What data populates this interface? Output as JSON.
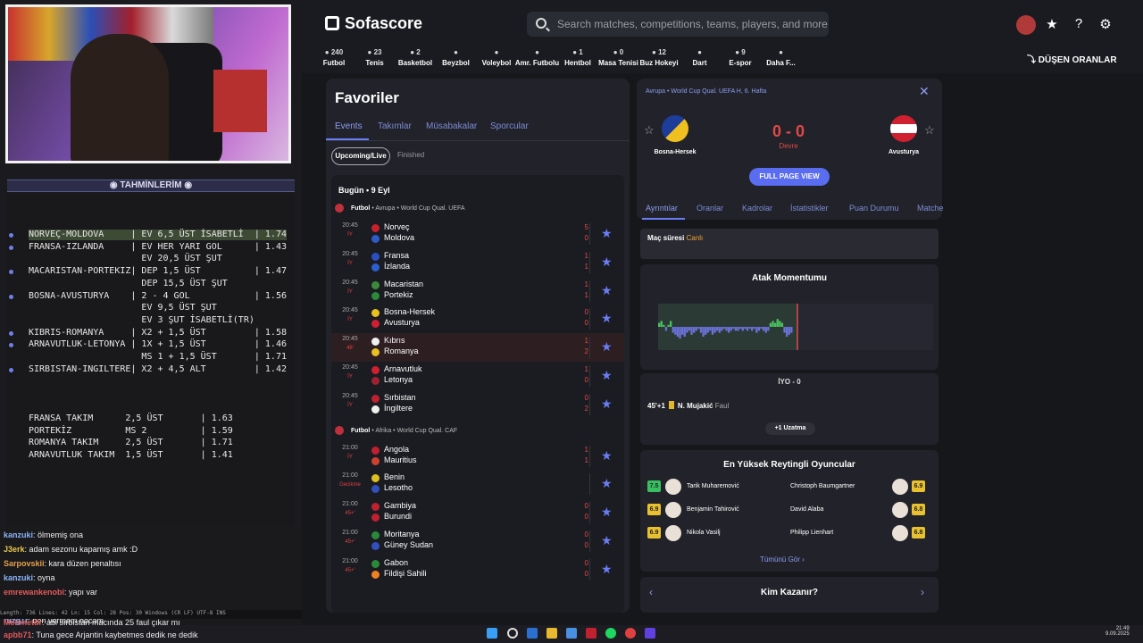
{
  "overlay": {
    "panel_title": "TAHMİNLERİM",
    "predictions": [
      {
        "text": "NORVEÇ-MOLDOVA     | EV 6,5 ÜST İSABETLİ  | 1.74",
        "highlight": true
      },
      {
        "text": "FRANSA-IZLANDA     | EV HER YARI GOL      | 1.43",
        "highlight": false
      },
      {
        "text": "                     EV 20,5 ÜST ŞUT",
        "highlight": false
      },
      {
        "text": "MACARISTAN-PORTEKIZ| DEP 1,5 ÜST          | 1.47",
        "highlight": false
      },
      {
        "text": "                     DEP 15,5 ÜST ŞUT",
        "highlight": false
      },
      {
        "text": "BOSNA-AVUSTURYA    | 2 - 4 GOL            | 1.56",
        "highlight": false
      },
      {
        "text": "                     EV 9,5 ÜST ŞUT",
        "highlight": false
      },
      {
        "text": "                     EV 3 ŞUT İSABETLİ(TR)",
        "highlight": false
      },
      {
        "text": "KIBRIS-ROMANYA     | X2 + 1,5 ÜST         | 1.58",
        "highlight": false
      },
      {
        "text": "ARNAVUTLUK-LETONYA | 1X + 1,5 ÜST         | 1.46",
        "highlight": false
      },
      {
        "text": "                     MS 1 + 1,5 ÜST       | 1.71",
        "highlight": false
      },
      {
        "text": "SIRBISTAN-INGILTERE| X2 + 4,5 ALT         | 1.42",
        "highlight": false
      }
    ],
    "extra": [
      "FRANSA TAKIM      2,5 ÜST       | 1.63",
      "PORTEKİZ          MS 2          | 1.59",
      "ROMANYA TAKIM     2,5 ÜST       | 1.71",
      "ARNAVUTLUK TAKIM  1,5 ÜST       | 1.41"
    ],
    "chat": [
      {
        "user": "kanzuki",
        "msg": ": ölmemiş ona",
        "color": "#8ab4f8"
      },
      {
        "user": "J3erk",
        "msg": ": adam sezonu kapamış amk :D",
        "color": "#e6c84a"
      },
      {
        "user": "Sarpovskii",
        "msg": ": kara düzen penaltısı",
        "color": "#e6a04a"
      },
      {
        "user": "kanzuki",
        "msg": ": oyna",
        "color": "#8ab4f8"
      },
      {
        "user": "emrewankenobi",
        "msg": ": yapı var",
        "color": "#e05a5a"
      },
      {
        "user": "",
        "msg": "Ben vermem hocam",
        "color": "#fff"
      },
      {
        "user": "ruzg1r",
        "msg": ": ben vermem hocam",
        "color": "#8ab4f8"
      }
    ],
    "chat_bottom": [
      {
        "user": "Mehmetdr",
        "msg": ": abi sırbistan macında 25 faul çıkar mı",
        "color": "#e05a5a"
      },
      {
        "user": "apbb71",
        "msg": ": Tuna gece Arjantin kaybetmes dedik ne dedik",
        "color": "#e05a5a"
      }
    ],
    "editor_status": "Length: 736   Lines: 42    Ln: 15    Col: 28   Pos: 30         Windows (CR LF)    UTF-8         INS"
  },
  "header": {
    "logo": "Sofascore",
    "search_placeholder": "Search matches, competitions, teams, players, and more",
    "sports": [
      {
        "icon": "football-icon",
        "count": "240",
        "label": "Futbol"
      },
      {
        "icon": "tennis-icon",
        "count": "23",
        "label": "Tenis"
      },
      {
        "icon": "basketball-icon",
        "count": "2",
        "label": "Basketbol"
      },
      {
        "icon": "baseball-icon",
        "count": "",
        "label": "Beyzbol"
      },
      {
        "icon": "volleyball-icon",
        "count": "",
        "label": "Voleybol"
      },
      {
        "icon": "american-football-icon",
        "count": "",
        "label": "Amr. Futbolu"
      },
      {
        "icon": "handball-icon",
        "count": "1",
        "label": "Hentbol"
      },
      {
        "icon": "table-tennis-icon",
        "count": "0",
        "label": "Masa Tenisi"
      },
      {
        "icon": "ice-hockey-icon",
        "count": "12",
        "label": "Buz Hokeyi"
      },
      {
        "icon": "darts-icon",
        "count": "",
        "label": "Dart"
      },
      {
        "icon": "esports-icon",
        "count": "9",
        "label": "E-spor"
      },
      {
        "icon": "more-icon",
        "count": "",
        "label": "Daha F..."
      }
    ],
    "dusen_oranlar": "DÜŞEN ORANLAR"
  },
  "favorites": {
    "title": "Favoriler",
    "tabs": [
      "Events",
      "Takımlar",
      "Müsabakalar",
      "Sporcular"
    ],
    "chips": [
      "Upcoming/Live",
      "Finished"
    ],
    "day": "Bugün • 9 Eyl",
    "groups": [
      {
        "sport": "Futbol",
        "comp": "• Avrupa • World Cup Qual. UEFA",
        "matches": [
          {
            "time": "20:45",
            "status": "İY",
            "home": "Norveç",
            "away": "Moldova",
            "hs": "5",
            "as": "0",
            "hf": "#c8202e",
            "af": "#2f5bc8",
            "live": false
          },
          {
            "time": "20:45",
            "status": "İY",
            "home": "Fransa",
            "away": "İzlanda",
            "hs": "1",
            "as": "1",
            "hf": "#2a4fc0",
            "af": "#2a5fd0",
            "live": false
          },
          {
            "time": "20:45",
            "status": "İY",
            "home": "Macaristan",
            "away": "Portekiz",
            "hs": "1",
            "as": "1",
            "hf": "#3a8a3a",
            "af": "#2a8a3a",
            "live": false
          },
          {
            "time": "20:45",
            "status": "İY",
            "home": "Bosna-Hersek",
            "away": "Avusturya",
            "hs": "0",
            "as": "0",
            "hf": "#e8c020",
            "af": "#d02030",
            "live": false
          },
          {
            "time": "20:45",
            "status": "48'",
            "home": "Kıbrıs",
            "away": "Romanya",
            "hs": "1",
            "as": "2",
            "hf": "#f0f0f0",
            "af": "#e8c020",
            "live": true
          },
          {
            "time": "20:45",
            "status": "İY",
            "home": "Arnavutluk",
            "away": "Letonya",
            "hs": "1",
            "as": "0",
            "hf": "#d02030",
            "af": "#a02030",
            "live": false
          },
          {
            "time": "20:45",
            "status": "İY",
            "home": "Sırbistan",
            "away": "İngiltere",
            "hs": "0",
            "as": "2",
            "hf": "#c02030",
            "af": "#f0f0f0",
            "live": false
          }
        ]
      },
      {
        "sport": "Futbol",
        "comp": "• Afrika • World Cup Qual. CAF",
        "matches": [
          {
            "time": "21:00",
            "status": "İY",
            "home": "Angola",
            "away": "Mauritius",
            "hs": "1",
            "as": "1",
            "hf": "#c02030",
            "af": "#d04030",
            "live": false
          },
          {
            "time": "21:00",
            "status": "Gecikme",
            "home": "Benin",
            "away": "Lesotho",
            "hs": "",
            "as": "",
            "hf": "#e0c020",
            "af": "#3050c0",
            "live": false
          },
          {
            "time": "21:00",
            "status": "45+'",
            "home": "Gambiya",
            "away": "Burundi",
            "hs": "0",
            "as": "0",
            "hf": "#c02030",
            "af": "#c02030",
            "live": false
          },
          {
            "time": "21:00",
            "status": "45+'",
            "home": "Moritanya",
            "away": "Güney Sudan",
            "hs": "0",
            "as": "0",
            "hf": "#2a8a3a",
            "af": "#3050c0",
            "live": false
          },
          {
            "time": "21:00",
            "status": "45+'",
            "home": "Gabon",
            "away": "Fildişi Sahili",
            "hs": "0",
            "as": "0",
            "hf": "#2a8a3a",
            "af": "#f08020",
            "live": false
          }
        ]
      }
    ]
  },
  "detail": {
    "breadcrumb": "Avrupa • World Cup Qual. UEFA H, 6. Hafta",
    "home": "Bosna-Hersek",
    "away": "Avusturya",
    "score": "0 - 0",
    "status": "Devre",
    "full_page": "FULL PAGE VIEW",
    "tabs": [
      "Ayrıntılar",
      "Oranlar",
      "Kadrolar",
      "İstatistikler",
      "Puan Durumu",
      "Matche"
    ],
    "mac_suresi_label": "Maç süresi",
    "mac_suresi_value": "Canlı",
    "momentum_title": "Atak Momentumu",
    "momentum": [
      0.2,
      0.3,
      0.1,
      -0.2,
      0.1,
      0.3,
      -0.3,
      -0.4,
      -0.5,
      -0.6,
      -0.4,
      -0.5,
      -0.3,
      -0.2,
      -0.4,
      -0.3,
      -0.2,
      -0.1,
      -0.3,
      -0.5,
      -0.4,
      -0.3,
      -0.2,
      -0.4,
      -0.3,
      -0.2,
      -0.3,
      -0.2,
      -0.1,
      -0.2,
      -0.3,
      -0.2,
      -0.1,
      -0.2,
      -0.2,
      -0.1,
      -0.2,
      -0.1,
      -0.2,
      -0.1,
      -0.2,
      -0.1,
      -0.3,
      -0.2,
      -0.1,
      -0.2,
      -0.3,
      -0.2,
      0.2,
      0.3,
      0.2,
      0.4,
      0.3,
      0.2,
      -0.3,
      -0.5,
      -0.4,
      -0.3
    ],
    "iyo_label": "İYO - 0",
    "event_minute": "45'+1",
    "event_player": "N. Mujakić",
    "event_type": "Faul",
    "uzatma": "+1 Uzatma",
    "top_title": "En Yüksek Reytingli Oyuncular",
    "players_home": [
      {
        "name": "Tarik Muharemović",
        "rating": "7.5",
        "color": "#38c060"
      },
      {
        "name": "Benjamin Tahirović",
        "rating": "6.9",
        "color": "#e8c030"
      },
      {
        "name": "Nikola Vasilj",
        "rating": "6.9",
        "color": "#e8c030"
      }
    ],
    "players_away": [
      {
        "name": "Christoph Baumgartner",
        "rating": "6.9",
        "color": "#e8c030"
      },
      {
        "name": "David Alaba",
        "rating": "6.8",
        "color": "#e8c030"
      },
      {
        "name": "Philipp Lienhart",
        "rating": "6.8",
        "color": "#e8c030"
      }
    ],
    "tumunu_gor": "Tümünü Gör",
    "kim_kazanir": "Kim Kazanır?"
  },
  "taskbar": {
    "time": "21:49",
    "date": "9.09.2025"
  }
}
